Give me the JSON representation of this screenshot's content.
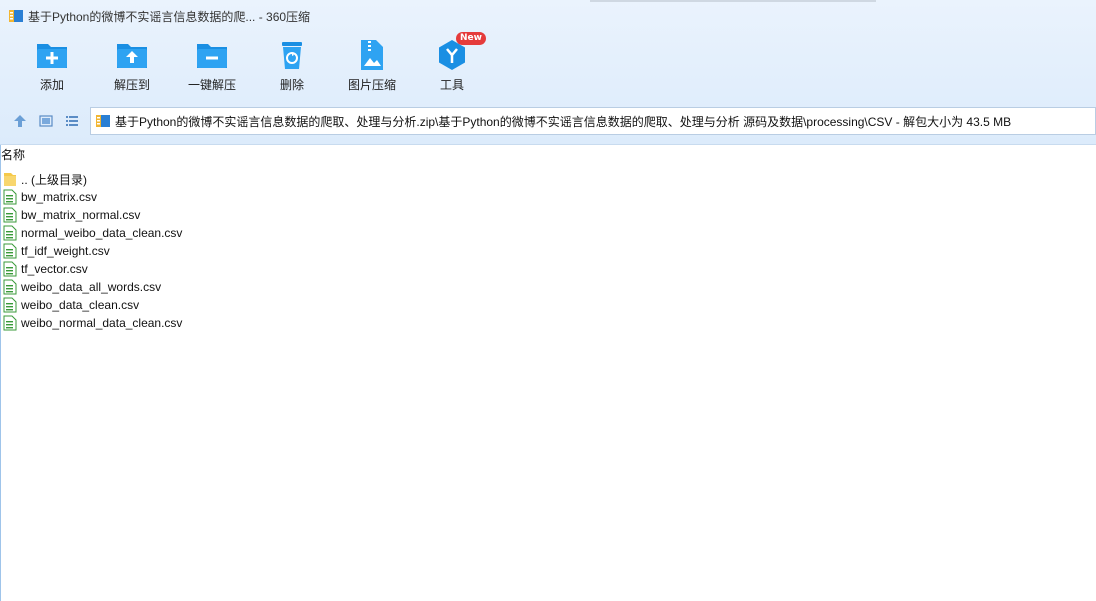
{
  "window": {
    "title": "基于Python的微博不实谣言信息数据的爬... - 360压缩"
  },
  "toolbar": {
    "buttons": [
      {
        "label": "添加",
        "icon": "add-archive-icon"
      },
      {
        "label": "解压到",
        "icon": "extract-to-icon"
      },
      {
        "label": "一键解压",
        "icon": "one-click-extract-icon"
      },
      {
        "label": "删除",
        "icon": "delete-icon"
      },
      {
        "label": "图片压缩",
        "icon": "image-compress-icon"
      },
      {
        "label": "工具",
        "icon": "tools-icon",
        "badge": "New"
      }
    ]
  },
  "path": {
    "text": "基于Python的微博不实谣言信息数据的爬取、处理与分析.zip\\基于Python的微博不实谣言信息数据的爬取、处理与分析 源码及数据\\processing\\CSV - 解包大小为 43.5 MB"
  },
  "list": {
    "header_name": "名称",
    "parent": ".. (上级目录)",
    "files": [
      "bw_matrix.csv",
      "bw_matrix_normal.csv",
      "normal_weibo_data_clean.csv",
      "tf_idf_weight.csv",
      "tf_vector.csv",
      "weibo_data_all_words.csv",
      "weibo_data_clean.csv",
      "weibo_normal_data_clean.csv"
    ]
  },
  "colors": {
    "toolbar_bg": "#dcebfb",
    "icon_blue": "#1a8fe3",
    "badge_red": "#e53b3b",
    "folder_yellow": "#f5c94a",
    "csv_green": "#3a9a3a"
  }
}
